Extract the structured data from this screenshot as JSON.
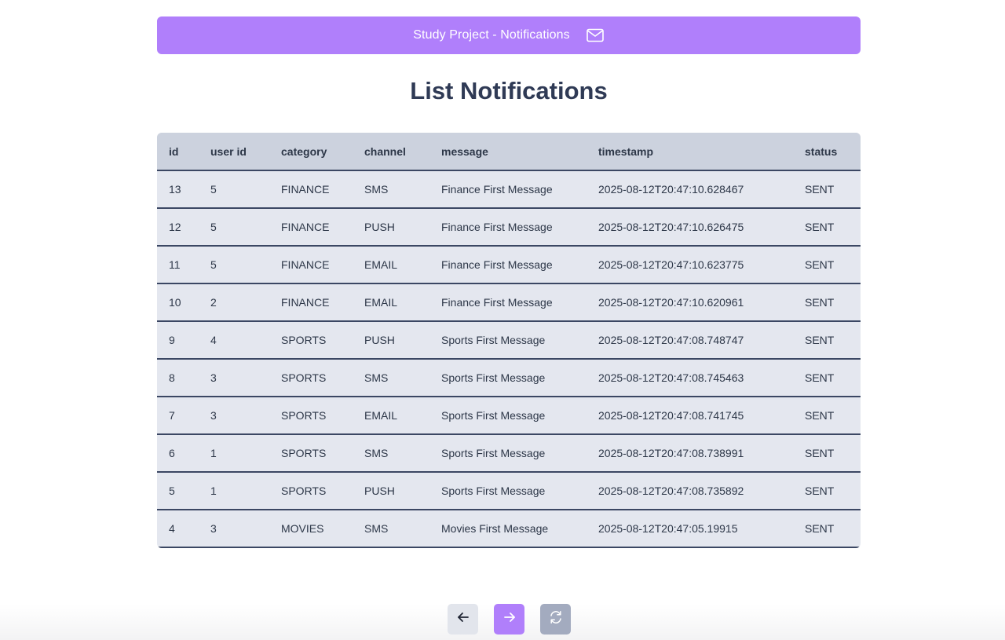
{
  "header": {
    "title": "Study Project - Notifications",
    "icon": "mail-icon",
    "accent_color": "#b07ffb"
  },
  "main": {
    "heading": "List Notifications"
  },
  "table": {
    "columns": [
      "id",
      "user id",
      "category",
      "channel",
      "message",
      "timestamp",
      "status"
    ],
    "rows": [
      [
        "13",
        "5",
        "FINANCE",
        "SMS",
        "Finance First Message",
        "2025-08-12T20:47:10.628467",
        "SENT"
      ],
      [
        "12",
        "5",
        "FINANCE",
        "PUSH",
        "Finance First Message",
        "2025-08-12T20:47:10.626475",
        "SENT"
      ],
      [
        "11",
        "5",
        "FINANCE",
        "EMAIL",
        "Finance First Message",
        "2025-08-12T20:47:10.623775",
        "SENT"
      ],
      [
        "10",
        "2",
        "FINANCE",
        "EMAIL",
        "Finance First Message",
        "2025-08-12T20:47:10.620961",
        "SENT"
      ],
      [
        "9",
        "4",
        "SPORTS",
        "PUSH",
        "Sports First Message",
        "2025-08-12T20:47:08.748747",
        "SENT"
      ],
      [
        "8",
        "3",
        "SPORTS",
        "SMS",
        "Sports First Message",
        "2025-08-12T20:47:08.745463",
        "SENT"
      ],
      [
        "7",
        "3",
        "SPORTS",
        "EMAIL",
        "Sports First Message",
        "2025-08-12T20:47:08.741745",
        "SENT"
      ],
      [
        "6",
        "1",
        "SPORTS",
        "SMS",
        "Sports First Message",
        "2025-08-12T20:47:08.738991",
        "SENT"
      ],
      [
        "5",
        "1",
        "SPORTS",
        "PUSH",
        "Sports First Message",
        "2025-08-12T20:47:08.735892",
        "SENT"
      ],
      [
        "4",
        "3",
        "MOVIES",
        "SMS",
        "Movies First Message",
        "2025-08-12T20:47:05.19915",
        "SENT"
      ]
    ]
  },
  "pager": {
    "prev_icon": "arrow-left-icon",
    "next_icon": "arrow-right-icon",
    "refresh_icon": "refresh-icon"
  }
}
